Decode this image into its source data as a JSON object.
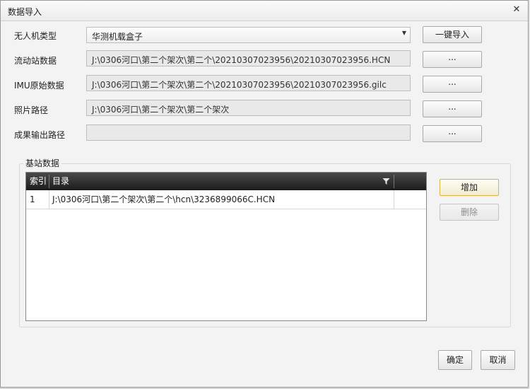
{
  "dialog": {
    "title": "数据导入"
  },
  "fields": {
    "uav_type": {
      "label": "无人机类型",
      "value": "华测机载盒子"
    },
    "rover": {
      "label": "流动站数据",
      "value": "J:\\0306河口\\第二个架次\\第二个\\20210307023956\\20210307023956.HCN"
    },
    "imu": {
      "label": "IMU原始数据",
      "value": "J:\\0306河口\\第二个架次\\第二个\\20210307023956\\20210307023956.gilc"
    },
    "photo": {
      "label": "照片路径",
      "value": "J:\\0306河口\\第二个架次\\第二个架次"
    },
    "output": {
      "label": "成果输出路径",
      "value": ""
    }
  },
  "buttons": {
    "one_key_import": "一键导入",
    "browse": "...",
    "add": "增加",
    "delete": "删除",
    "ok": "确定",
    "cancel": "取消"
  },
  "base_station": {
    "group_title": "基站数据",
    "columns": [
      "索引",
      "目录"
    ],
    "rows": [
      {
        "index": "1",
        "path": "J:\\0306河口\\第二个架次\\第二个\\hcn\\3236899066C.HCN"
      }
    ]
  },
  "icons": {
    "close": "close-icon",
    "dropdown": "chevron-down-icon",
    "filter": "filter-icon"
  }
}
